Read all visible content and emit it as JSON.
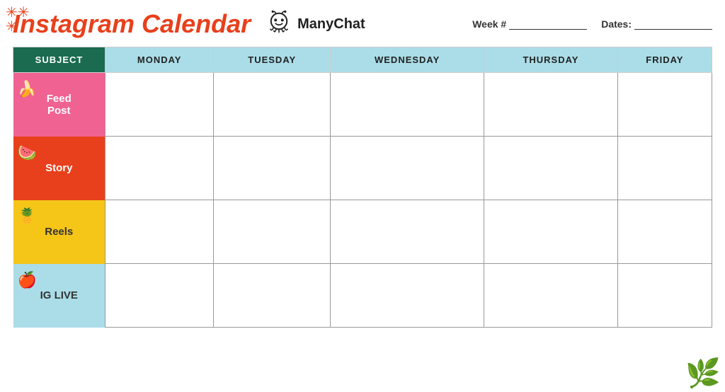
{
  "header": {
    "title": "Instagram Calendar",
    "manychat_label": "ManyChat",
    "week_label": "Week #",
    "dates_label": "Dates:"
  },
  "table": {
    "columns": {
      "subject": "SUBJECT",
      "monday": "MONDAY",
      "tuesday": "TUESDAY",
      "wednesday": "WEDNESDAY",
      "thursday": "THURSDAY",
      "friday": "FRIDAY"
    },
    "rows": [
      {
        "id": "feed",
        "label": "Feed\nPost",
        "emoji": "🍌",
        "color_class": "subject-feed",
        "row_class": "row-feed"
      },
      {
        "id": "story",
        "label": "Story",
        "emoji": "🍉",
        "color_class": "subject-story",
        "row_class": "row-story"
      },
      {
        "id": "reels",
        "label": "Reels",
        "emoji": "🍍",
        "color_class": "subject-reels",
        "row_class": "row-reels"
      },
      {
        "id": "iglive",
        "label": "IG LIVE",
        "emoji": "🍎",
        "color_class": "subject-iglive",
        "row_class": "row-iglive"
      }
    ]
  },
  "decorations": {
    "sparkles": "✳️",
    "leaf": "🌿"
  }
}
